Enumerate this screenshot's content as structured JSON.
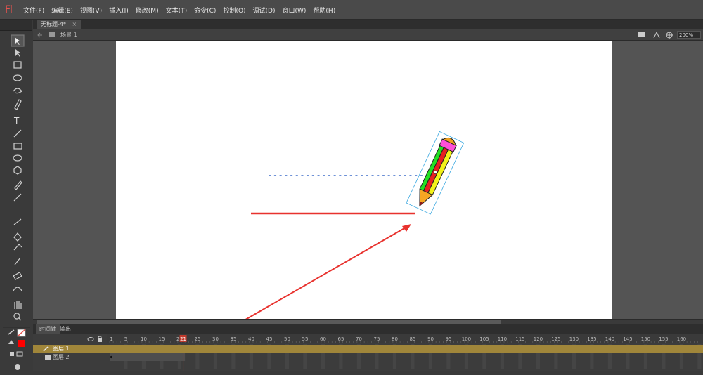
{
  "app": {
    "logo": "Fl"
  },
  "menu": [
    "文件(F)",
    "编辑(E)",
    "视图(V)",
    "插入(I)",
    "修改(M)",
    "文本(T)",
    "命令(C)",
    "控制(O)",
    "调试(D)",
    "窗口(W)",
    "帮助(H)"
  ],
  "doc_tab": {
    "label": "无标题-4*",
    "close": "×"
  },
  "edit_bar": {
    "scene": "场景 1",
    "zoom": "200%"
  },
  "timeline": {
    "tabs": [
      "时间轴",
      "输出"
    ],
    "frame_numbers": [
      "1",
      "5",
      "10",
      "15",
      "20",
      "25",
      "30",
      "35",
      "40",
      "45",
      "50",
      "55",
      "60",
      "65",
      "70",
      "75",
      "80",
      "85",
      "90",
      "95",
      "100",
      "105",
      "110",
      "115",
      "120",
      "125",
      "130",
      "135",
      "140",
      "145",
      "150",
      "155",
      "160"
    ],
    "playhead_frame": "21",
    "layers": [
      {
        "name": "图层 1",
        "selected": true
      },
      {
        "name": "图层 2",
        "selected": false
      }
    ]
  },
  "colors": {
    "stroke": "#333333",
    "fill": "#ff0000",
    "accent": "#e8534e"
  }
}
